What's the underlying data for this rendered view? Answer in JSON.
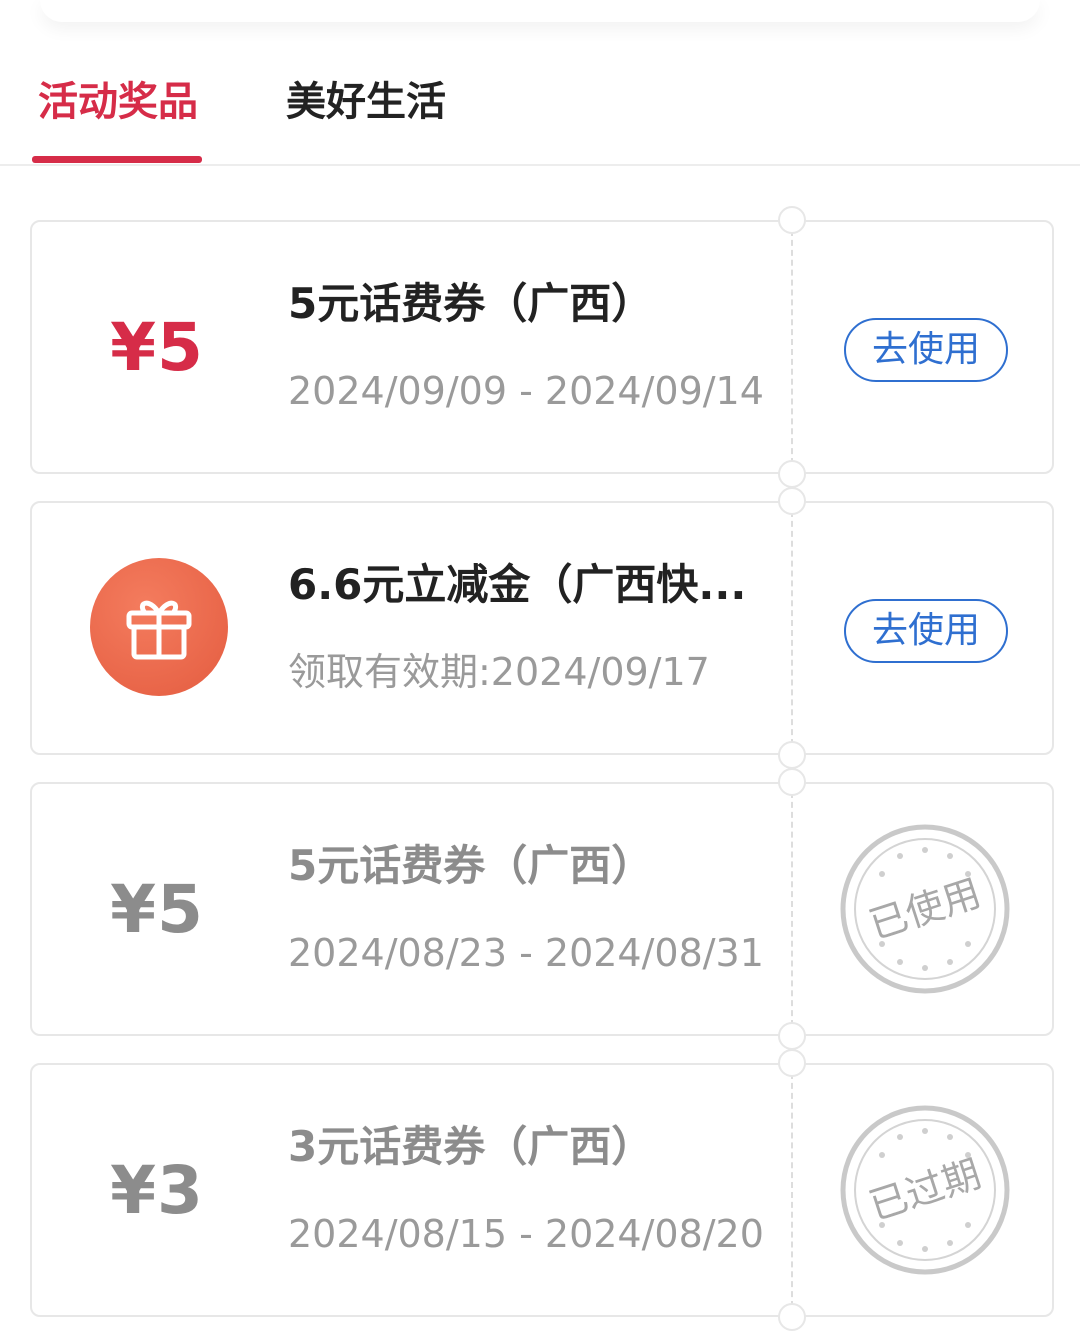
{
  "tabs": [
    {
      "label": "活动奖品",
      "active": true
    },
    {
      "label": "美好生活",
      "active": false
    }
  ],
  "colors": {
    "accent": "#d62c48",
    "link": "#2f6fd0",
    "muted": "#8c8c8c"
  },
  "coupons": [
    {
      "amount": "¥5",
      "title": "5元话费券（广西）",
      "date": "2024/09/09 - 2024/09/14",
      "action": "去使用",
      "status": "active"
    },
    {
      "icon": "gift-icon",
      "title": "6.6元立减金（广西快...",
      "date": "领取有效期:2024/09/17",
      "action": "去使用",
      "status": "active"
    },
    {
      "amount": "¥5",
      "title": "5元话费券（广西）",
      "date": "2024/08/23 - 2024/08/31",
      "stamp": "已使用",
      "status": "used"
    },
    {
      "amount": "¥3",
      "title": "3元话费券（广西）",
      "date": "2024/08/15 - 2024/08/20",
      "stamp": "已过期",
      "status": "expired"
    }
  ]
}
